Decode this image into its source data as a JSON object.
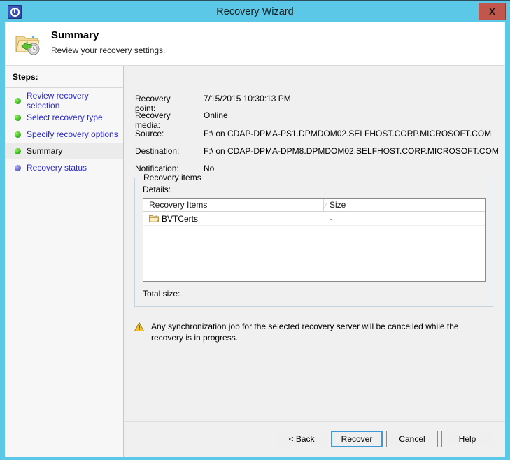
{
  "window": {
    "title": "Recovery Wizard",
    "app_icon": "recovery-clock-icon",
    "close_label": "X",
    "titlebar_color": "#5bc8e8"
  },
  "header": {
    "icon": "folder-restore-icon",
    "title": "Summary",
    "subtitle": "Review your recovery settings."
  },
  "sidebar": {
    "heading": "Steps:",
    "items": [
      {
        "label": "Review recovery selection",
        "state": "done"
      },
      {
        "label": "Select recovery type",
        "state": "done"
      },
      {
        "label": "Specify recovery options",
        "state": "done"
      },
      {
        "label": "Summary",
        "state": "current"
      },
      {
        "label": "Recovery status",
        "state": "pending"
      }
    ]
  },
  "summary": {
    "fields": [
      {
        "name": "Recovery point:",
        "value": "7/15/2015 10:30:13 PM"
      },
      {
        "name": "Recovery media:",
        "value": "Online"
      },
      {
        "name": "Source:",
        "value": "F:\\ on CDAP-DPMA-PS1.DPMDOM02.SELFHOST.CORP.MICROSOFT.COM"
      },
      {
        "name": "Destination:",
        "value": "F:\\ on CDAP-DPMA-DPM8.DPMDOM02.SELFHOST.CORP.MICROSOFT.COM"
      },
      {
        "name": "Notification:",
        "value": "No"
      }
    ]
  },
  "recovery_items": {
    "group_title": "Recovery items",
    "details_label": "Details:",
    "columns": [
      "Recovery Items",
      "Size"
    ],
    "sort_indicator": "⁄",
    "rows": [
      {
        "icon": "folder-icon",
        "name": "BVTCerts",
        "size": "-"
      }
    ],
    "total_size_label": "Total size:",
    "total_size_value": ""
  },
  "warning": {
    "icon": "warning-triangle-icon",
    "text": "Any synchronization job for the selected recovery server will be cancelled while the recovery is in progress."
  },
  "footer": {
    "buttons": [
      {
        "label": "< Back",
        "default": false
      },
      {
        "label": "Recover",
        "default": true
      },
      {
        "label": "Cancel",
        "default": false
      },
      {
        "label": "Help",
        "default": false
      }
    ]
  }
}
